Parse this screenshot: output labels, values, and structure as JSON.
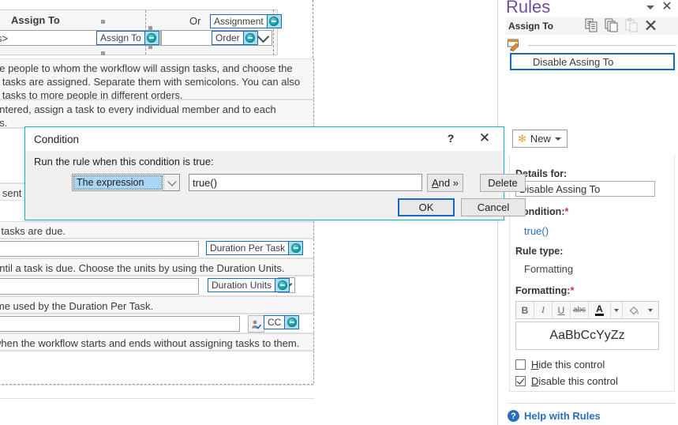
{
  "design": {
    "top_table": {
      "col1_header": "Assign To",
      "col2_header": "Or",
      "left_field_value": "s>",
      "tags": [
        {
          "label": "Assign To"
        },
        {
          "label": "Assignment"
        },
        {
          "label": "Order"
        }
      ]
    },
    "paragraphs": [
      "he people to whom the workflow will assign tasks, and choose the",
      "e tasks are assigned. Separate them with semicolons. You can also",
      "n tasks to more people in different orders.",
      "entered, assign a task to every individual member and to each",
      "ns.",
      "e sent",
      "ll tasks are due.",
      "until a task is due. Choose the units by using the Duration Units.",
      "ime used by the Duration Per Task.",
      "when the workflow starts and ends without assigning tasks to them."
    ],
    "duration_per_task_tag": "Duration Per Task",
    "duration_units_tag": "Duration Units",
    "cc_tag": "CC"
  },
  "dialog": {
    "title": "Condition",
    "help_glyph": "?",
    "close_glyph": "✕",
    "prompt": "Run the rule when this condition is true:",
    "condition_type": "The expression",
    "expression_value": "true()",
    "buttons": {
      "and": "And »",
      "delete": "Delete",
      "ok": "OK",
      "cancel": "Cancel"
    }
  },
  "rules_pane": {
    "title": "Rules",
    "collapse_glyph": "▾",
    "close_glyph": "✕",
    "context_label": "Assign To",
    "toolbar": [
      "copy-rule-icon",
      "duplicate-rule-icon",
      "paste-rule-icon",
      "delete-rule-icon"
    ],
    "rule_items": [
      {
        "label": "Disable Assing To",
        "selected": true
      }
    ],
    "new_button": {
      "label": "New",
      "star_glyph": "✻"
    },
    "details": {
      "details_for_label": "Details for:",
      "details_for_value": "Disable Assing To",
      "condition_label": "Condition:",
      "condition_required": "*",
      "condition_value": "true()",
      "rule_type_label": "Rule type:",
      "rule_type_value": "Formatting",
      "formatting_label": "Formatting:",
      "formatting_required": "*",
      "format_buttons": [
        "B",
        "I",
        "U",
        "abc"
      ],
      "font_color_glyph": "A",
      "highlight_glyph": "◳",
      "preview_text": "AaBbCcYyZz",
      "checkboxes": [
        {
          "label": "Hide this control",
          "accel": "H",
          "rest": "ide this control",
          "checked": false
        },
        {
          "label": "Disable this control",
          "accel": "D",
          "rest": "isable this control",
          "checked": true
        }
      ]
    },
    "help": {
      "icon_glyph": "?",
      "label": "Help with Rules"
    }
  },
  "colors": {
    "accent_blue": "#1569c7",
    "dialog_border": "#1ab0c8",
    "rules_title": "#6f4fa0",
    "link": "#2a6fbb",
    "required": "#cc3333",
    "tag_teal": "#17a3ae"
  }
}
